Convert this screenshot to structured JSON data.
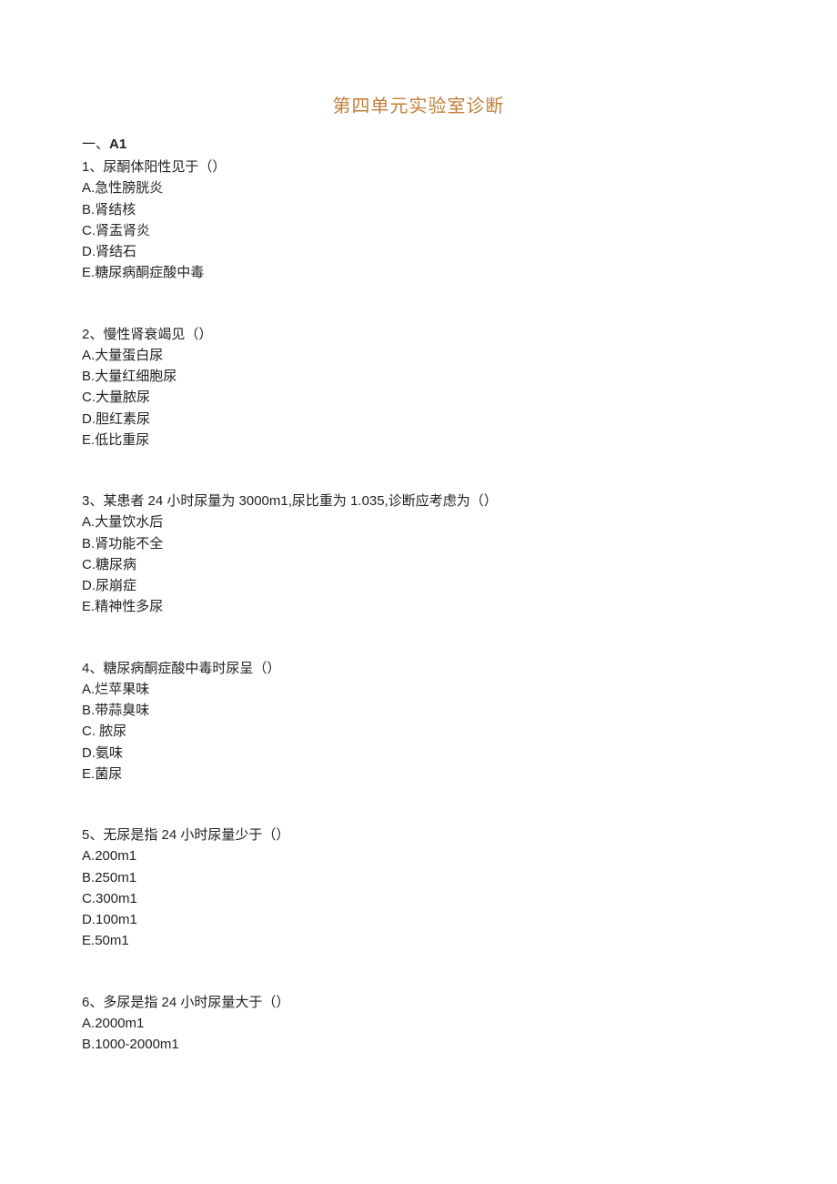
{
  "title": "第四单元实验室诊断",
  "section": {
    "prefix": "一、",
    "label": "A1"
  },
  "questions": [
    {
      "num": "1、",
      "stem": "尿酮体阳性见于（）",
      "options": [
        {
          "p": "A.",
          "t": "急性膀胱炎"
        },
        {
          "p": "B.",
          "t": "肾结核"
        },
        {
          "p": "C.",
          "t": "肾盂肾炎"
        },
        {
          "p": "D.",
          "t": "肾结石"
        },
        {
          "p": "E.",
          "t": "糖尿病酮症酸中毒"
        }
      ]
    },
    {
      "num": "2、",
      "stem": "慢性肾衰竭见（）",
      "options": [
        {
          "p": "A.",
          "t": "大量蛋白尿"
        },
        {
          "p": "B.",
          "t": "大量红细胞尿"
        },
        {
          "p": "C.",
          "t": "大量脓尿"
        },
        {
          "p": "D.",
          "t": "胆红素尿"
        },
        {
          "p": "E.",
          "t": "低比重尿"
        }
      ]
    },
    {
      "num": "3、",
      "stem": "某患者 24 小时尿量为 3000m1,尿比重为 1.035,诊断应考虑为（）",
      "options": [
        {
          "p": "A.",
          "t": "大量饮水后"
        },
        {
          "p": "B.",
          "t": "肾功能不全"
        },
        {
          "p": "C.",
          "t": "糖尿病"
        },
        {
          "p": "D.",
          "t": "尿崩症"
        },
        {
          "p": "E.",
          "t": "精神性多尿"
        }
      ]
    },
    {
      "num": "4、",
      "stem": "糖尿病酮症酸中毒时尿呈（）",
      "options": [
        {
          "p": "A.",
          "t": "烂苹果味"
        },
        {
          "p": "B.",
          "t": "带蒜臭味"
        },
        {
          "p": "C. ",
          "t": "脓尿"
        },
        {
          "p": "D.",
          "t": "氨味"
        },
        {
          "p": "E.",
          "t": "菌尿"
        }
      ]
    },
    {
      "num": "5、",
      "stem": "无尿是指 24 小时尿量少于（）",
      "options": [
        {
          "p": "A.",
          "t": "200m1"
        },
        {
          "p": "B.",
          "t": "250m1"
        },
        {
          "p": "C.",
          "t": "300m1"
        },
        {
          "p": "D.",
          "t": "100m1"
        },
        {
          "p": "E.",
          "t": "50m1"
        }
      ]
    },
    {
      "num": "6、",
      "stem": "多尿是指 24 小时尿量大于（）",
      "options": [
        {
          "p": "A.",
          "t": "2000m1"
        },
        {
          "p": "B.",
          "t": "1000-2000m1"
        }
      ]
    }
  ]
}
